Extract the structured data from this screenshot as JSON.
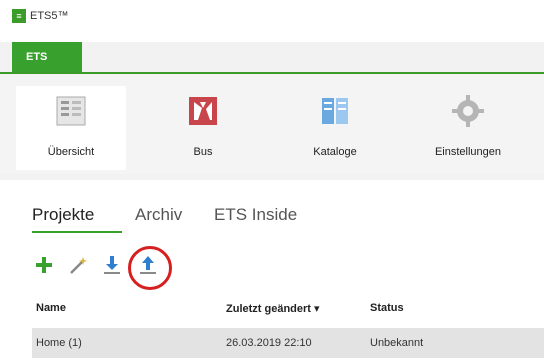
{
  "window": {
    "title": "ETS5™"
  },
  "app_tab": {
    "label": "ETS"
  },
  "ribbon": {
    "buttons": [
      {
        "label": "Übersicht",
        "icon": "overview-icon",
        "active": true
      },
      {
        "label": "Bus",
        "icon": "bus-icon"
      },
      {
        "label": "Kataloge",
        "icon": "catalog-icon"
      },
      {
        "label": "Einstellungen",
        "icon": "gear-icon"
      }
    ]
  },
  "tabs": [
    {
      "label": "Projekte",
      "active": true
    },
    {
      "label": "Archiv"
    },
    {
      "label": "ETS Inside"
    }
  ],
  "toolbar": {
    "icons": [
      "add-icon",
      "edit-wand-icon",
      "import-icon",
      "export-icon"
    ],
    "highlight_color": "#d61f1f"
  },
  "table": {
    "headers": {
      "name": "Name",
      "modified": "Zuletzt geändert ▾",
      "status": "Status"
    },
    "rows": [
      {
        "name": "Home (1)",
        "modified": "26.03.2019 22:10",
        "status": "Unbekannt"
      }
    ]
  },
  "colors": {
    "accent": "#38a02d",
    "ribbon_bg": "#f4f4f4",
    "row_bg": "#e3e3e3"
  }
}
